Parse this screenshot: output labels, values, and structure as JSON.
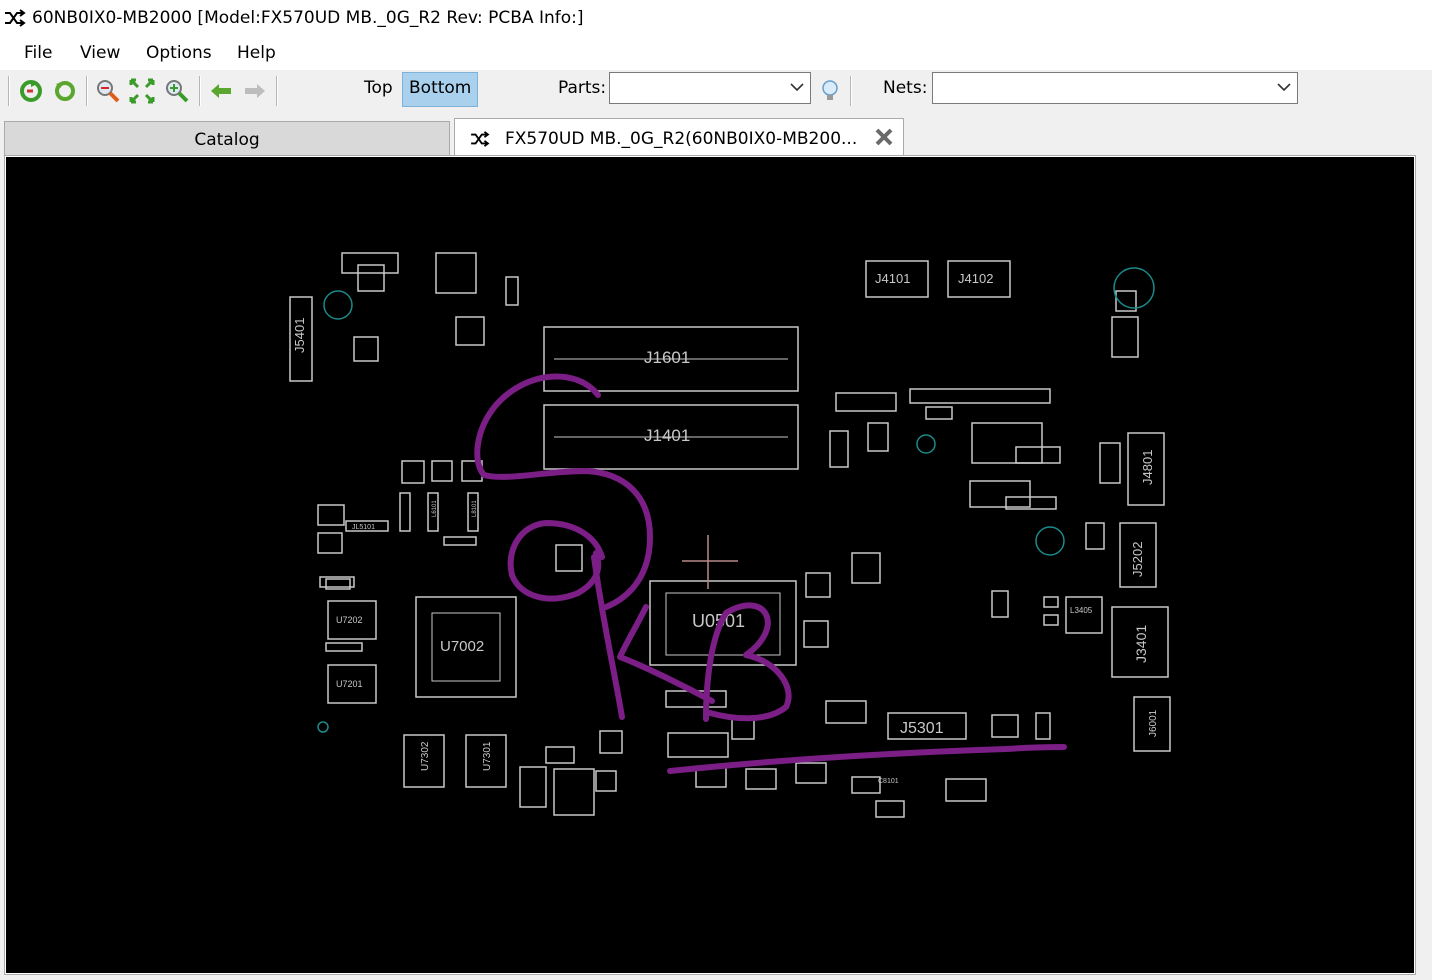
{
  "window": {
    "title": "60NB0IX0-MB2000 [Model:FX570UD MB._0G_R2 Rev: PCBA Info:]",
    "icon": "shuffle-icon"
  },
  "menu": {
    "items": [
      "File",
      "View",
      "Options",
      "Help"
    ]
  },
  "toolbar": {
    "icons": [
      "refresh-icon",
      "rotate-icon",
      "zoom-out-icon",
      "fit-icon",
      "zoom-in-icon",
      "arrow-left-icon",
      "arrow-right-icon"
    ],
    "side_top": "Top",
    "side_bottom": "Bottom",
    "active_side": "Bottom",
    "parts_label": "Parts:",
    "parts_value": "",
    "nets_label": "Nets:",
    "nets_value": "",
    "search_icon": "lightbulb-icon"
  },
  "tabs": {
    "catalog": "Catalog",
    "board": "FX570UD MB._0G_R2(60NB0IX0-MB200..."
  },
  "board": {
    "background": "#000000",
    "component_color": "#c8c8c8",
    "annotation_color": "#7b1e85",
    "designators": [
      "J4101",
      "J4102",
      "J1601",
      "J1401",
      "U0501",
      "J4801",
      "J5202",
      "J3401",
      "J6001",
      "J5301",
      "U7202",
      "U7201",
      "U7002",
      "U7302",
      "U7301",
      "J5401",
      "L3405"
    ],
    "designators_aux": [
      "JL5101",
      "L6101",
      "L8101",
      "C8101"
    ],
    "labels_center": "U0501"
  }
}
